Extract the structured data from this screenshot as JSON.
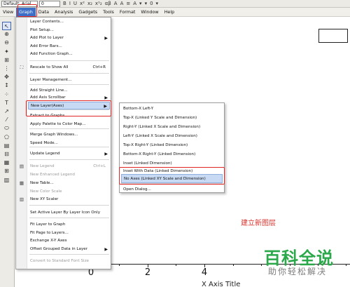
{
  "format_toolbar": {
    "font_name": "Default: Arial",
    "font_size": "0",
    "glyphs": [
      "B",
      "I",
      "U",
      "x²",
      "x₂",
      "x¹₂",
      "αβ",
      "A",
      "A",
      "≡",
      "A",
      "▾",
      "▾",
      "0",
      "▾"
    ]
  },
  "menu_bar": {
    "items": [
      "View",
      "Graph",
      "Data",
      "Analysis",
      "Gadgets",
      "Tools",
      "Format",
      "Window",
      "Help"
    ],
    "active_index": 1
  },
  "tools": [
    "↖",
    "⊕",
    "⊖",
    "✦",
    "⊞",
    "⋮",
    "✥",
    "↕",
    "⁘",
    "T",
    "↗",
    "⁄",
    "⬭",
    "⬠",
    "▤",
    "⊟",
    "▦",
    "⊞",
    "▥"
  ],
  "graph_menu": {
    "items": [
      {
        "label": "Layer Contents..."
      },
      {
        "label": "Plot Setup..."
      },
      {
        "label": "Add Plot to Layer",
        "submenu": true
      },
      {
        "label": "Add Error Bars..."
      },
      {
        "label": "Add Function Graph..."
      },
      {
        "label": "Rescale to Show All",
        "shortcut": "Ctrl+R",
        "icon": "⛶"
      },
      {
        "label": "Layer Management..."
      },
      {
        "label": "Add Straight Line..."
      },
      {
        "label": "Add Axis Scrollbar",
        "submenu": true
      },
      {
        "label": "New Layer(Axes)",
        "submenu": true,
        "highlight": true
      },
      {
        "label": "Extract to Graphs..."
      },
      {
        "label": "Apply Palette to Color Map..."
      },
      {
        "label": "Merge Graph Windows..."
      },
      {
        "label": "Speed Mode..."
      },
      {
        "label": "Update Legend",
        "submenu": true
      },
      {
        "label": "New Legend",
        "shortcut": "Ctrl+L",
        "icon": "▤",
        "disabled": true
      },
      {
        "label": "New Enhanced Legend",
        "disabled": true
      },
      {
        "label": "New Table...",
        "icon": "▦"
      },
      {
        "label": "New Color Scale",
        "disabled": true
      },
      {
        "label": "New XY Scaler",
        "icon": "▥"
      },
      {
        "label": "Set Active Layer By Layer Icon Only"
      },
      {
        "label": "Fit Layer to Graph"
      },
      {
        "label": "Fit Page to Layers..."
      },
      {
        "label": "Exchange X-Y Axes"
      },
      {
        "label": "Offset Grouped Data in Layer",
        "submenu": true
      },
      {
        "label": "Convert to Standard Font Size",
        "disabled": true
      }
    ]
  },
  "layer_submenu": {
    "items": [
      {
        "label": "Bottom-X Left-Y"
      },
      {
        "label": "Top-X (Linked Y Scale and Dimension)"
      },
      {
        "label": "Right-Y (Linked X Scale and Dimension)"
      },
      {
        "label": "Left-Y (Linked X Scale and Dimension)"
      },
      {
        "label": "Top-X Right-Y (Linked Dimension)"
      },
      {
        "label": "Bottom-X Right-Y (Linked Dimension)"
      },
      {
        "label": "Inset (Linked Dimension)"
      },
      {
        "label": "Inset With Data (Linked Dimension)"
      },
      {
        "label": "No Axes (Linked XY Scale and Dimension)",
        "highlight": true
      },
      {
        "label": "Open Dialog..."
      }
    ]
  },
  "graph": {
    "x_ticks": [
      "0",
      "2",
      "4"
    ],
    "caption": "建立新图层",
    "axis_title": "X Axis Title"
  },
  "watermark": {
    "line1": "百科全说",
    "line2": "助你轻松解决"
  },
  "colors": {
    "menu_active": "#3b6fc8",
    "highlight": "#c7d9f3",
    "annotation_red": "#e02727",
    "caption_red": "#d9332c",
    "watermark_green": "#2aa84a"
  }
}
